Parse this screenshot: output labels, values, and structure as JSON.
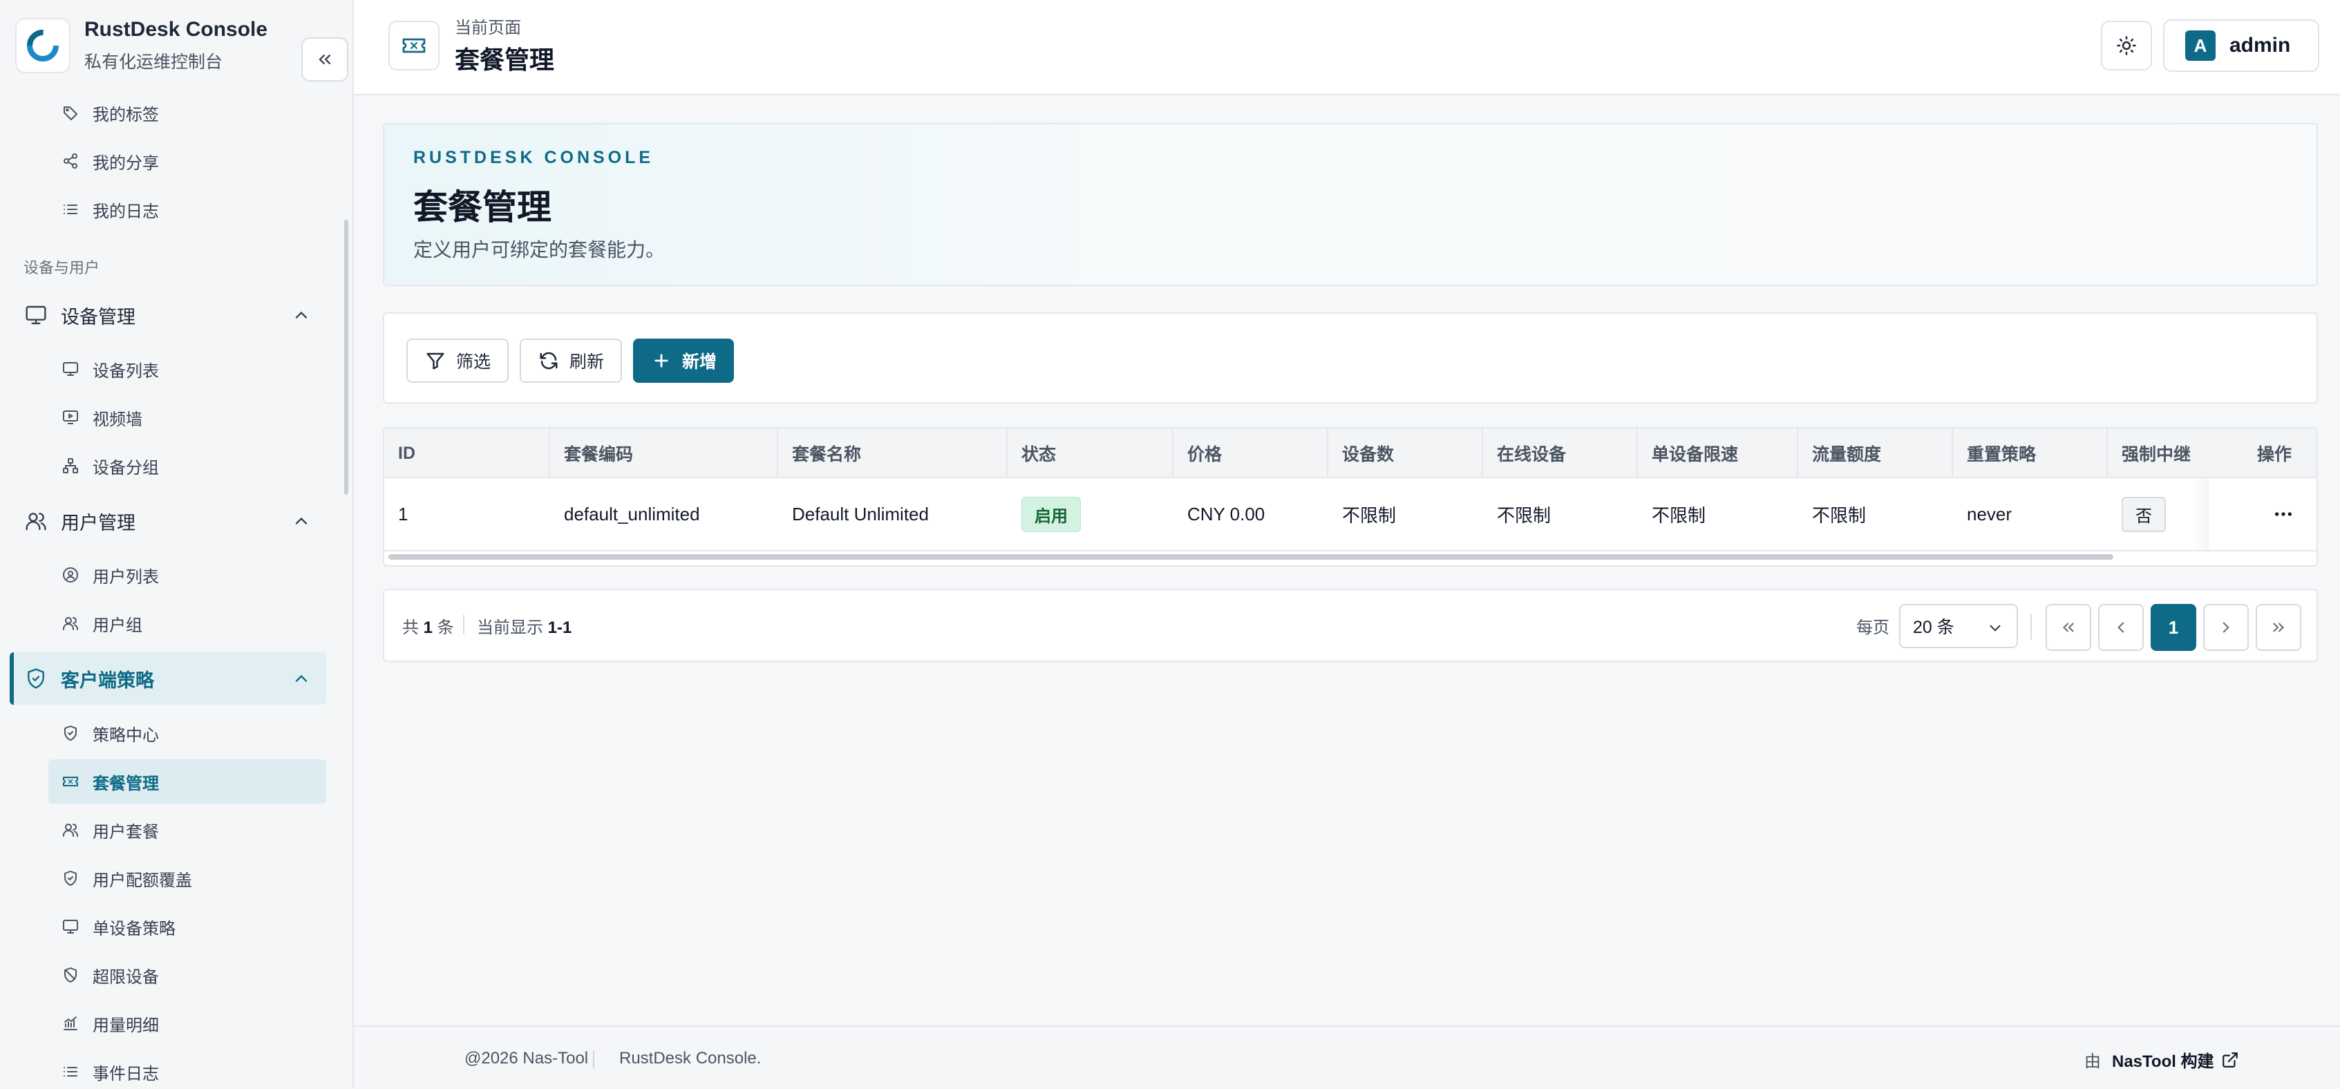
{
  "brand": {
    "title": "RustDesk Console",
    "subtitle": "私有化运维控制台"
  },
  "sidebar": {
    "top_items": [
      {
        "label": "我的标签",
        "icon": "tag-icon"
      },
      {
        "label": "我的分享",
        "icon": "share-icon"
      },
      {
        "label": "我的日志",
        "icon": "list-icon"
      }
    ],
    "group_label": "设备与用户",
    "device_mgmt": {
      "label": "设备管理",
      "items": [
        {
          "label": "设备列表"
        },
        {
          "label": "视频墙"
        },
        {
          "label": "设备分组"
        }
      ]
    },
    "user_mgmt": {
      "label": "用户管理",
      "items": [
        {
          "label": "用户列表"
        },
        {
          "label": "用户组"
        }
      ]
    },
    "client_policy": {
      "label": "客户端策略",
      "items": [
        {
          "label": "策略中心"
        },
        {
          "label": "套餐管理"
        },
        {
          "label": "用户套餐"
        },
        {
          "label": "用户配额覆盖"
        },
        {
          "label": "单设备策略"
        },
        {
          "label": "超限设备"
        },
        {
          "label": "用量明细"
        },
        {
          "label": "事件日志"
        }
      ]
    }
  },
  "header": {
    "crumb_label": "当前页面",
    "page_title": "套餐管理",
    "user": {
      "initial": "A",
      "name": "admin"
    }
  },
  "hero": {
    "kicker": "RUSTDESK CONSOLE",
    "title": "套餐管理",
    "description": "定义用户可绑定的套餐能力。"
  },
  "toolbar": {
    "filter_label": "筛选",
    "refresh_label": "刷新",
    "add_label": "新增"
  },
  "table": {
    "columns": [
      "ID",
      "套餐编码",
      "套餐名称",
      "状态",
      "价格",
      "设备数",
      "在线设备",
      "单设备限速",
      "流量额度",
      "重置策略",
      "强制中继",
      "操作"
    ],
    "rows": [
      {
        "id": "1",
        "code": "default_unlimited",
        "name": "Default Unlimited",
        "status": "启用",
        "price": "CNY 0.00",
        "devices": "不限制",
        "online": "不限制",
        "speed": "不限制",
        "traffic": "不限制",
        "reset": "never",
        "relay": "否"
      }
    ]
  },
  "pagination": {
    "total_prefix": "共",
    "total": "1",
    "total_suffix": "条",
    "range_prefix": "当前显示",
    "range": "1-1",
    "per_page_label": "每页",
    "per_page_value": "20 条",
    "current_page": "1"
  },
  "footer": {
    "copyright": "@2026 Nas-Tool",
    "app": "RustDesk Console.",
    "by_prefix": "由",
    "by_name": "NasTool 构建"
  },
  "colors": {
    "accent": "#0e6a86",
    "status_on_bg": "#d3f2e2",
    "status_on_text": "#166534"
  }
}
